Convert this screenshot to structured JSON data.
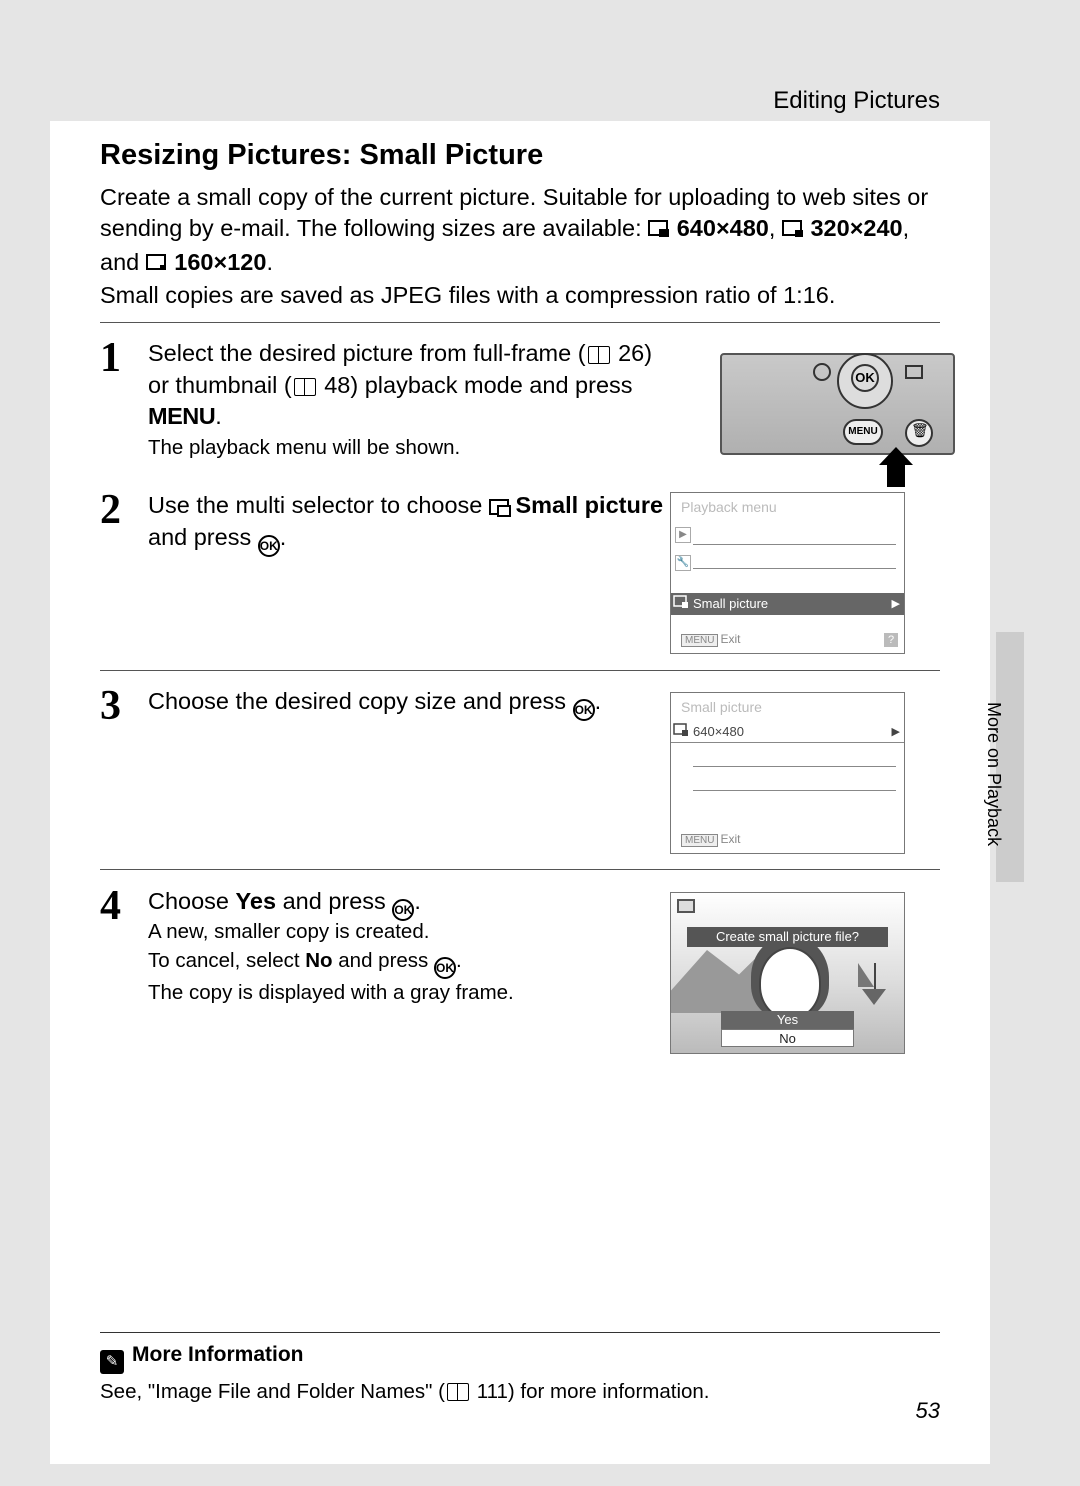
{
  "header": {
    "section": "Editing Pictures"
  },
  "title": "Resizing Pictures: Small Picture",
  "intro": {
    "line1": "Create a small copy of the current picture. Suitable for uploading to web sites or sending by e-mail. The following sizes are available: ",
    "size1": "640×480",
    "size2": "320×240",
    "and": ", and ",
    "size3": "160×120",
    "period": ".",
    "line2": "Small copies are saved as JPEG files with a compression ratio of 1:16."
  },
  "steps": {
    "s1": {
      "num": "1",
      "heading_a": "Select the desired picture from full-frame (",
      "ref1": "26",
      "heading_b": ") or thumbnail (",
      "ref2": "48",
      "heading_c": ") playback mode and press ",
      "menu": "MENU",
      "heading_d": ".",
      "note": "The playback menu will be shown."
    },
    "s2": {
      "num": "2",
      "heading_a": "Use the multi selector to choose ",
      "label": "Small picture",
      "heading_b": " and press ",
      "ok": "OK",
      "heading_c": "."
    },
    "s3": {
      "num": "3",
      "heading_a": "Choose the desired copy size and press ",
      "ok": "OK",
      "heading_b": "."
    },
    "s4": {
      "num": "4",
      "heading_a": "Choose ",
      "yes": "Yes",
      "heading_b": " and press ",
      "ok": "OK",
      "heading_c": ".",
      "note1": "A new, smaller copy is created.",
      "note2a": "To cancel, select ",
      "no": "No",
      "note2b": " and press ",
      "note2c": ".",
      "note3": "The copy is displayed with a gray frame."
    }
  },
  "camera": {
    "ok_label": "OK",
    "menu_label": "MENU"
  },
  "screen2": {
    "title": "Playback menu",
    "item": "Small picture",
    "exit_btn": "MENU",
    "exit": "Exit",
    "help": "?"
  },
  "screen3": {
    "title": "Small picture",
    "item": "640×480",
    "exit_btn": "MENU",
    "exit": "Exit"
  },
  "screen4": {
    "banner": "Create small picture file?",
    "yes": "Yes",
    "no": "No"
  },
  "side_label": "More on Playback",
  "more": {
    "title": "More Information",
    "text_a": "See, \"Image File and Folder Names\" (",
    "ref": "111",
    "text_b": ") for more information."
  },
  "page_number": "53"
}
